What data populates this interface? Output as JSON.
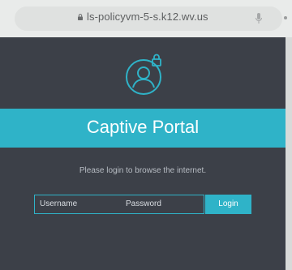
{
  "browser": {
    "url": "ls-policyvm-5-s.k12.wv.us",
    "icons": [
      "lock-icon",
      "mic-icon"
    ]
  },
  "portal": {
    "title": "Captive Portal",
    "notice": "Please login to browse the internet.",
    "username_placeholder": "Username",
    "password_placeholder": "Password",
    "login_label": "Login",
    "accent_color": "#2fb3c8",
    "background_color": "#3c4048",
    "icon": "user-lock-icon"
  }
}
